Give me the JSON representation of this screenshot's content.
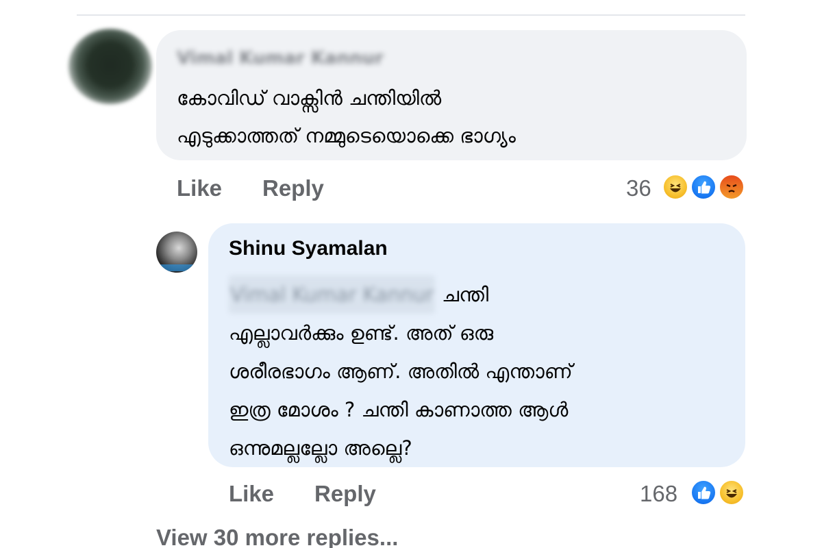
{
  "comment": {
    "author": "Vimal Kumar Kannur",
    "lines": [
      "കോവിഡ് വാക്സിൻ ചന്തിയിൽ",
      "എടുക്കാത്തത് നമ്മുടെയൊക്കെ ഭാഗ്യം"
    ],
    "like_label": "Like",
    "reply_label": "Reply",
    "reaction_count": "36",
    "reactions": [
      "haha-reaction-icon",
      "like-reaction-icon",
      "angry-reaction-icon"
    ]
  },
  "reply": {
    "author": "Shinu Syamalan",
    "mention": "Vimal Kumar Kannur",
    "first_line_rest": "ചന്തി",
    "lines": [
      "എല്ലാവർക്കും ഉണ്ട്. അത് ഒരു",
      "ശരീരഭാഗം ആണ്. അതിൽ എന്താണ്",
      "ഇത്ര മോശം ? ചന്തി കാണാത്ത ആൾ",
      "ഒന്നുമല്ലല്ലോ അല്ലെ?"
    ],
    "like_label": "Like",
    "reply_label": "Reply",
    "reaction_count": "168",
    "reactions": [
      "like-reaction-icon",
      "haha-reaction-icon"
    ]
  },
  "view_more": "View 30 more replies...",
  "colors": {
    "bubble_grey": "#f0f2f5",
    "bubble_blue": "#e7f0fb",
    "secondary_text": "#65676b",
    "like_blue": "#1877f2",
    "haha_yellow": "#f7c02d",
    "angry_orange": "#e74c1b"
  }
}
